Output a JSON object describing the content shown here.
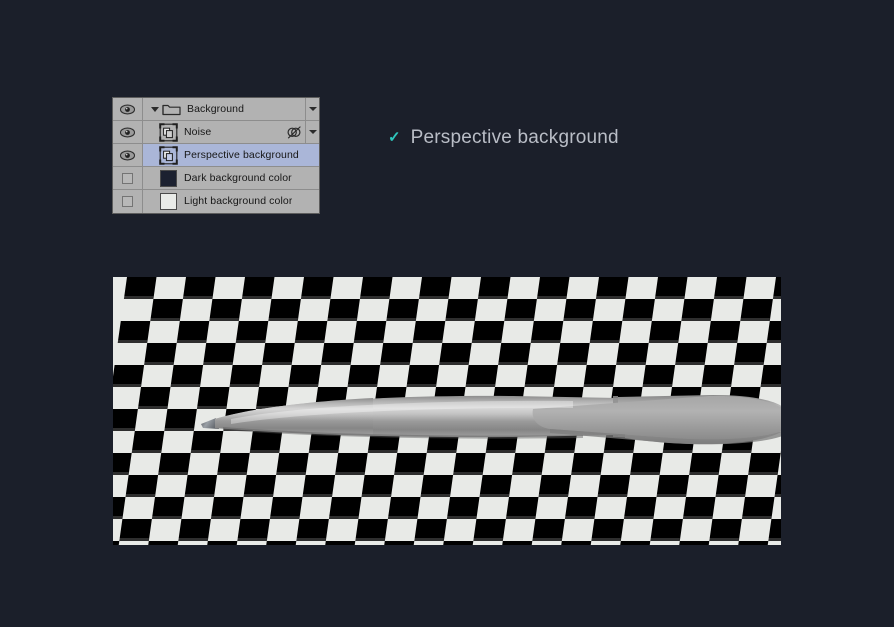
{
  "app": {
    "background_color": "#1b1f2a",
    "accent_color": "#2ec6bd"
  },
  "layers_panel": {
    "name": "Layers",
    "panel_background": "#b2b2b2",
    "selection_color": "#aab6d8",
    "rows": [
      {
        "id": "background-group",
        "label": "Background",
        "visible": true,
        "visibility_icon": "eye-icon",
        "thumb_icon": "folder-icon",
        "disclosure": "chevron-down-icon",
        "selected": false,
        "has_fx": false,
        "has_expand": true
      },
      {
        "id": "noise",
        "label": "Noise",
        "visible": true,
        "visibility_icon": "eye-icon",
        "thumb_icon": "smart-object-icon",
        "selected": false,
        "has_fx": true,
        "fx_icon": "effects-icon",
        "has_expand": true
      },
      {
        "id": "perspective-background",
        "label": "Perspective background",
        "visible": true,
        "visibility_icon": "eye-icon",
        "thumb_icon": "smart-object-icon",
        "selected": true,
        "has_fx": false,
        "has_expand": false
      },
      {
        "id": "dark-background-color",
        "label": "Dark background color",
        "visible": false,
        "visibility_icon": "empty-checkbox-icon",
        "thumb_icon": "color-swatch",
        "swatch_color": "#1c2130",
        "selected": false,
        "has_fx": false,
        "has_expand": false
      },
      {
        "id": "light-background-color",
        "label": "Light background color",
        "visible": false,
        "visibility_icon": "empty-checkbox-icon",
        "thumb_icon": "color-swatch",
        "swatch_color": "#e9ebe8",
        "selected": false,
        "has_fx": false,
        "has_expand": false
      }
    ]
  },
  "caption": {
    "check_glyph": "✓",
    "text": "Perspective background"
  },
  "canvas": {
    "name": "transparency-checkerboard-preview",
    "checker_light": "#e8eae7",
    "checker_dark": "#000000",
    "artwork": {
      "name": "pen-mockup",
      "body_color": "#9a9a9a",
      "clip_color": "#9c9c9c",
      "tip_color": "#6e7277"
    }
  }
}
